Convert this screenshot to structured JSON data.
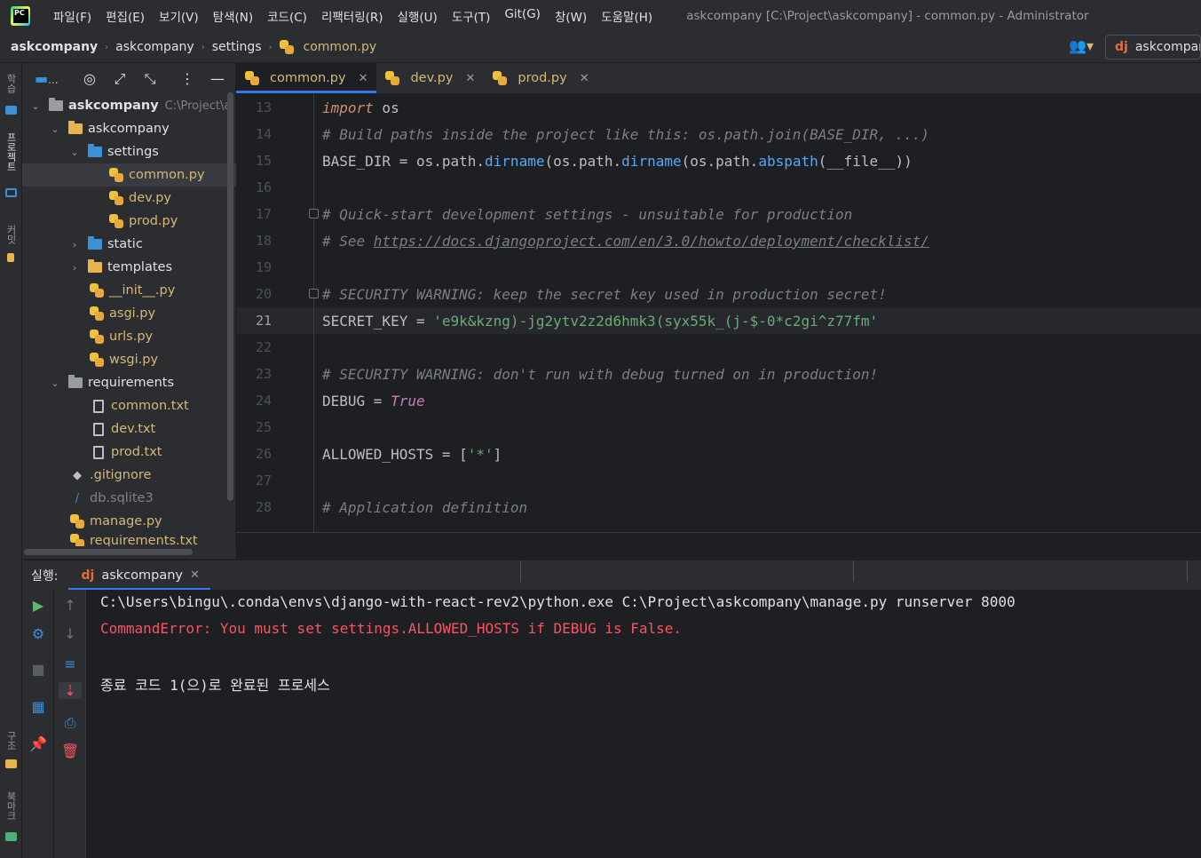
{
  "menu": [
    "파일(F)",
    "편집(E)",
    "보기(V)",
    "탐색(N)",
    "코드(C)",
    "리팩터링(R)",
    "실행(U)",
    "도구(T)",
    "Git(G)",
    "창(W)",
    "도움말(H)"
  ],
  "window_title": "askcompany [C:\\Project\\askcompany] - common.py - Administrator",
  "breadcrumbs": [
    "askcompany",
    "askcompany",
    "settings",
    "common.py"
  ],
  "run_config": {
    "icon": "dj",
    "label": "askcompany"
  },
  "left_strip": {
    "top_label": "학습",
    "project_label": "프로젝트",
    "commit_label": "커밋",
    "structure_label": "구조",
    "bookmarks_label": "북마크"
  },
  "project_toolbar": {
    "view_label": "..."
  },
  "tree": [
    {
      "label": "askcompany",
      "extra": "C:\\Project\\a",
      "type": "root",
      "open": true
    },
    {
      "label": "askcompany",
      "type": "folder-yellow",
      "open": true
    },
    {
      "label": "settings",
      "type": "folder-blue",
      "open": true
    },
    {
      "label": "common.py",
      "type": "py",
      "selected": true
    },
    {
      "label": "dev.py",
      "type": "py"
    },
    {
      "label": "prod.py",
      "type": "py"
    },
    {
      "label": "static",
      "type": "folder-blue",
      "open": false
    },
    {
      "label": "templates",
      "type": "folder-yellow",
      "open": false
    },
    {
      "label": "__init__.py",
      "type": "py"
    },
    {
      "label": "asgi.py",
      "type": "py"
    },
    {
      "label": "urls.py",
      "type": "py"
    },
    {
      "label": "wsgi.py",
      "type": "py"
    },
    {
      "label": "requirements",
      "type": "folder",
      "open": true
    },
    {
      "label": "common.txt",
      "type": "txt"
    },
    {
      "label": "dev.txt",
      "type": "txt"
    },
    {
      "label": "prod.txt",
      "type": "txt"
    },
    {
      "label": ".gitignore",
      "type": "git"
    },
    {
      "label": "db.sqlite3",
      "type": "db"
    },
    {
      "label": "manage.py",
      "type": "py"
    },
    {
      "label": "requirements.txt",
      "type": "py"
    }
  ],
  "tabs": [
    {
      "label": "common.py",
      "active": true
    },
    {
      "label": "dev.py"
    },
    {
      "label": "prod.py"
    }
  ],
  "code": {
    "line_numbers": [
      "13",
      "14",
      "15",
      "16",
      "17",
      "18",
      "19",
      "20",
      "21",
      "22",
      "23",
      "24",
      "25",
      "26",
      "27",
      "28"
    ],
    "current_line": "21",
    "l13_kw": "import",
    "l13_rest": " os",
    "l14": "# Build paths inside the project like this: os.path.join(BASE_DIR, ...)",
    "l15_a": "BASE_DIR = os.path.",
    "l15_fn1": "dirname",
    "l15_b": "(os.path.",
    "l15_fn2": "dirname",
    "l15_c": "(os.path.",
    "l15_fn3": "abspath",
    "l15_d": "(__file__))",
    "l17": "# Quick-start development settings - unsuitable for production",
    "l18_a": "# See ",
    "l18_link": "https://docs.djangoproject.com/en/3.0/howto/deployment/checklist/",
    "l20": "# SECURITY WARNING: keep the secret key used in production secret!",
    "l21_a": "SECRET_KEY = ",
    "l21_str": "'e9k&kzng)-jg2ytv2z2d6hmk3(syx55k_(j-$-0*c2gi^z77fm'",
    "l23": "# SECURITY WARNING: don't run with debug turned on in production!",
    "l24_a": "DEBUG = ",
    "l24_true": "True",
    "l26_a": "ALLOWED_HOSTS = [",
    "l26_str": "'*'",
    "l26_b": "]",
    "l28": "# Application definition"
  },
  "run": {
    "label": "실행:",
    "tab_icon": "dj",
    "tab_label": "askcompany",
    "console": [
      {
        "text": "C:\\Users\\bingu\\.conda\\envs\\django-with-react-rev2\\python.exe C:\\Project\\askcompany\\manage.py runserver 8000",
        "type": "normal"
      },
      {
        "text": "CommandError: You must set settings.ALLOWED_HOSTS if DEBUG is False.",
        "type": "error"
      },
      {
        "text": "종료 코드 1(으)로 완료된 프로세스",
        "type": "normal"
      }
    ]
  },
  "colors": {
    "accent": "#3574f0",
    "error": "#f75464",
    "string": "#6aab73",
    "keyword": "#cf8e6d"
  }
}
